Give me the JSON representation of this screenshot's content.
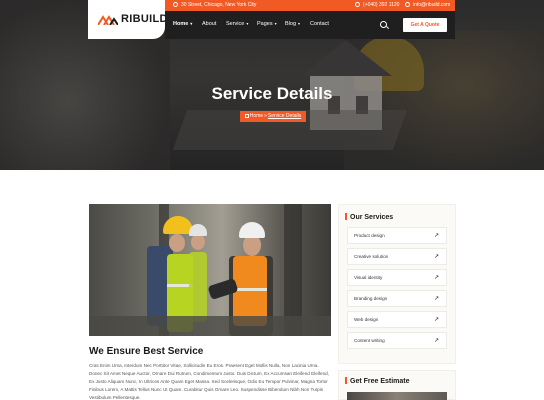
{
  "brand": {
    "name": "RIBUILD",
    "accent": "#f15a24",
    "dark": "#1f1f1f"
  },
  "topbar": {
    "address": "30 Street, Chicago, New York City",
    "phone": "(+040) 392 1120",
    "email": "info@ribuild.com"
  },
  "nav": {
    "items": [
      {
        "label": "Home",
        "dropdown": true,
        "active": true
      },
      {
        "label": "About",
        "dropdown": false
      },
      {
        "label": "Service",
        "dropdown": true
      },
      {
        "label": "Pages",
        "dropdown": true
      },
      {
        "label": "Blog",
        "dropdown": true
      },
      {
        "label": "Contact",
        "dropdown": false
      }
    ],
    "search_icon": "search-icon",
    "quote_button": "Get A Quote"
  },
  "hero": {
    "title": "Service Details",
    "breadcrumb": {
      "home": "Home",
      "separator": "»",
      "current": "Service Details"
    }
  },
  "main": {
    "heading": "We Ensure Best Service",
    "paragraph": "Cras Enim Urna, Interdum Nec Porttitor Vitae, Sollicitudin Eu Eros. Praesent Eget Mollis Nulla, Non Lacinia Urna. Donec Sit Amet Neque Auctor, Ornare Dui Rutrum, Condimentum Justo. Duis Dictum, Ex Accumsan Eleifend Eleifend, Ex Justo Aliquam Nunc, In Ultrices Ante Quam Eget Massa. Sed Scelerisque, Odio Eu Tempor Pulvinar, Magna Tortor Finibus Lorem, A Mattis Tellus Nunc Ut Quam. Curabitur Quis Ornare Leo. Suspendisse Bibendum Nibh Non Turpis Vestibulum Pellentesque."
  },
  "sidebar": {
    "title": "Our Services",
    "services": [
      {
        "label": "Product design"
      },
      {
        "label": "Creative solution"
      },
      {
        "label": "Visual identity"
      },
      {
        "label": "Branding design"
      },
      {
        "label": "Web design"
      },
      {
        "label": "Content writing"
      }
    ],
    "arrow_glyph": "↗",
    "estimate_title": "Get Free Estimate"
  }
}
